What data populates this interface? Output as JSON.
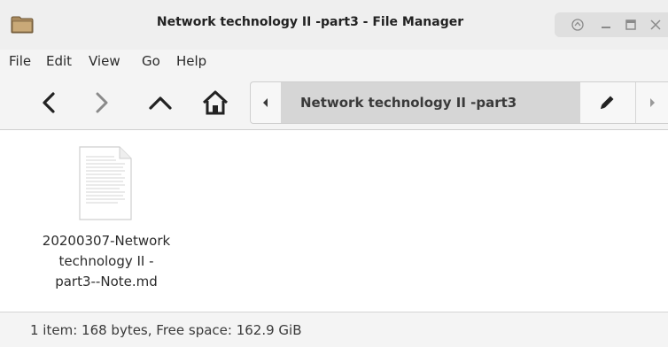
{
  "window": {
    "title": "Network technology II -part3 - File Manager",
    "icon": "folder-icon",
    "controls": [
      "shade-icon",
      "minimize-icon",
      "maximize-icon",
      "close-icon"
    ]
  },
  "menu": {
    "items": [
      {
        "label": "File"
      },
      {
        "label": "Edit"
      },
      {
        "label": "View"
      },
      {
        "label": "Go"
      },
      {
        "label": "Help"
      }
    ]
  },
  "toolbar": {
    "buttons": [
      "back-icon",
      "forward-icon",
      "up-icon",
      "home-icon"
    ]
  },
  "pathbar": {
    "current": "Network technology II -part3",
    "edit_icon": "pencil-icon"
  },
  "files": [
    {
      "name_lines": [
        "20200307-Network",
        "technology II -",
        "part3--Note.md"
      ],
      "icon": "text-document-icon"
    }
  ],
  "status": {
    "text": "1 item: 168 bytes, Free space: 162.9 GiB"
  },
  "colors": {
    "titlebar": "#efefef",
    "toolbar": "#f4f4f4",
    "crumb_active": "#d6d6d6",
    "content": "#ffffff"
  }
}
